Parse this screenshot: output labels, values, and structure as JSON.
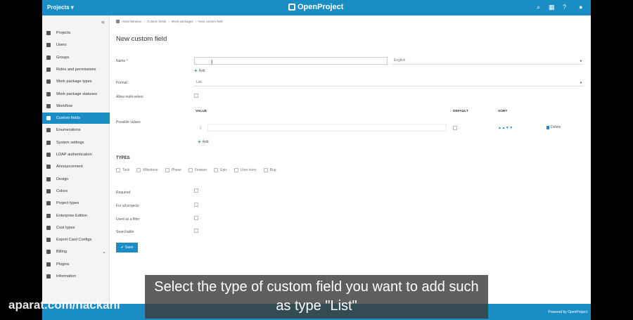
{
  "header": {
    "projects_label": "Projects ▾",
    "logo_text": "OpenProject",
    "icons": [
      "search-icon",
      "grid-icon",
      "help-icon",
      "user-icon"
    ]
  },
  "sidebar": {
    "items": [
      {
        "label": "Projects",
        "icon": "projects-icon"
      },
      {
        "label": "Users",
        "icon": "user-icon"
      },
      {
        "label": "Groups",
        "icon": "group-icon"
      },
      {
        "label": "Roles and permissions",
        "icon": "key-icon"
      },
      {
        "label": "Work package types",
        "icon": "tag-icon"
      },
      {
        "label": "Work package statuses",
        "icon": "flag-icon"
      },
      {
        "label": "Workflow",
        "icon": "workflow-icon"
      },
      {
        "label": "Custom fields",
        "icon": "custom-fields-icon"
      },
      {
        "label": "Enumerations",
        "icon": "list-icon"
      },
      {
        "label": "System settings",
        "icon": "gear-icon"
      },
      {
        "label": "LDAP authentication",
        "icon": "key-icon"
      },
      {
        "label": "Announcement",
        "icon": "megaphone-icon"
      },
      {
        "label": "Design",
        "icon": "design-icon"
      },
      {
        "label": "Colors",
        "icon": "palette-icon"
      },
      {
        "label": "Project types",
        "icon": "projects-icon"
      },
      {
        "label": "Enterprise Edition",
        "icon": "enterprise-icon"
      },
      {
        "label": "Cost types",
        "icon": "cost-icon"
      },
      {
        "label": "Export Card Configs",
        "icon": "export-icon"
      },
      {
        "label": "Billing",
        "icon": "billing-icon"
      },
      {
        "label": "Plugins",
        "icon": "plugin-icon"
      },
      {
        "label": "Information",
        "icon": "info-icon"
      }
    ],
    "active_index": 7
  },
  "breadcrumb": [
    "Administration",
    "Custom fields",
    "Work packages",
    "New custom field"
  ],
  "page_title": "New custom field",
  "form": {
    "name_label": "Name *",
    "name_value": "",
    "language_value": "English",
    "add_label": "Add",
    "format_label": "Format",
    "format_value": "List",
    "multi_select_label": "Allow multi-select",
    "possible_values_label": "Possible values",
    "col_value": "VALUE",
    "col_default": "DEFAULT",
    "col_sort": "SORT",
    "sort_arrows": "▲▲▼▼",
    "delete_label": "Delete",
    "types_heading": "TYPES",
    "types": [
      "Task",
      "Milestone",
      "Phase",
      "Feature",
      "Epic",
      "User story",
      "Bug"
    ],
    "required_label": "Required",
    "for_all_projects_label": "For all projects",
    "used_in_filter_label": "Used as a filter",
    "searchable_label": "Searchable",
    "save_label": "Save"
  },
  "footer": {
    "powered_by": "Powered by OpenProject"
  },
  "subtitle": "Select the type of custom field you want to add such as type \"List\"",
  "watermark": "aparat.com/hackani",
  "colors": {
    "brand": "#1a8ec4",
    "add_green": "#35a853"
  }
}
